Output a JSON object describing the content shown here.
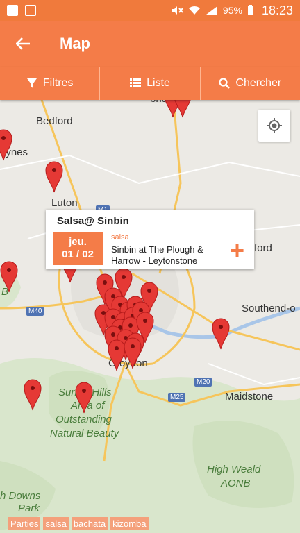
{
  "status_bar": {
    "battery": "95%",
    "time": "18:23"
  },
  "app_bar": {
    "title": "Map"
  },
  "toolbar": {
    "filters_label": "Filtres",
    "list_label": "Liste",
    "search_label": "Chercher"
  },
  "map": {
    "labels": {
      "bedford": "Bedford",
      "keynes": "eynes",
      "luton": "Luton",
      "ford": "ford",
      "southend": "Southend-o",
      "croydon": "Croydon",
      "maidstone": "Maidstone",
      "surrey_hills": "Surrey Hills",
      "aonb_line1": "Area of",
      "aonb_line2": "Outstanding",
      "aonb_line3": "Natural Beauty",
      "high_weald_1": "High Weald",
      "high_weald_2": "AONB",
      "downs_1": "h Downs",
      "downs_2": "Park",
      "b_fragment": "B",
      "bridge": "bridge"
    },
    "roads": {
      "m40": "M40",
      "m1": "M1",
      "m20": "M20",
      "m25": "M25"
    }
  },
  "popup": {
    "title": "Salsa@ Sinbin",
    "date_line1": "jeu.",
    "date_line2": "01 / 02",
    "category": "salsa",
    "venue": "Sinbin at The Plough & Harrow - Leytonstone",
    "add_symbol": "+"
  },
  "tags": [
    "Parties",
    "salsa",
    "bachata",
    "kizomba"
  ],
  "colors": {
    "accent": "#f47c48",
    "pin": "#e53935"
  }
}
